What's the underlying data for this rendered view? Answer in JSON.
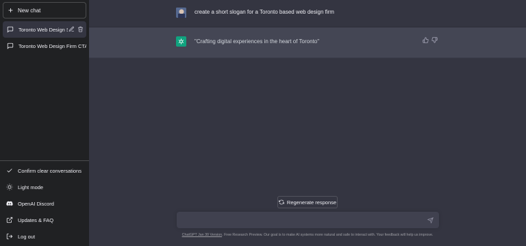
{
  "sidebar": {
    "new_chat_label": "New chat",
    "conversations": [
      {
        "title": "Toronto Web Design Sl",
        "active": true
      },
      {
        "title": "Toronto Web Design Firm CTA",
        "active": false
      }
    ],
    "bottom_items": [
      {
        "label": "Confirm clear conversations",
        "icon": "check-icon"
      },
      {
        "label": "Light mode",
        "icon": "sun-icon"
      },
      {
        "label": "OpenAI Discord",
        "icon": "discord-icon"
      },
      {
        "label": "Updates & FAQ",
        "icon": "external-link-icon"
      },
      {
        "label": "Log out",
        "icon": "logout-icon"
      }
    ]
  },
  "conversation": {
    "user_message": "create a short slogan for a Toronto based web design firm",
    "assistant_message": "\"Crafting digital experiences in the heart of Toronto\""
  },
  "composer": {
    "regenerate_label": "Regenerate response",
    "input_value": "",
    "input_placeholder": ""
  },
  "footer": {
    "version_link": "ChatGPT Jan 30 Version",
    "text": ". Free Research Preview. Our goal is to make AI systems more natural and safe to interact with. Your feedback will help us improve."
  },
  "colors": {
    "sidebar_bg": "#202123",
    "main_bg": "#343541",
    "assistant_bg": "#444654",
    "accent": "#10a37f",
    "input_bg": "#40414f"
  }
}
